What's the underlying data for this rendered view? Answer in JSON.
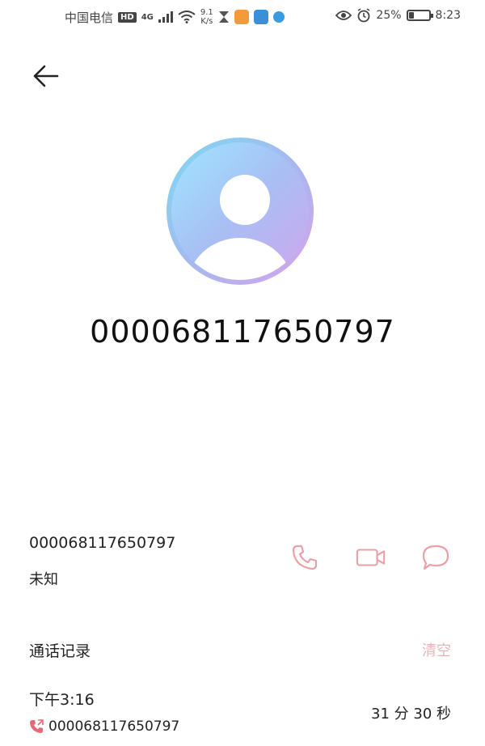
{
  "status_bar": {
    "carrier": "中国电信",
    "hd_badge": "HD",
    "network": "4G",
    "speed_value": "9.1",
    "speed_unit": "K/s",
    "battery": "25%",
    "battery_level": 0.25,
    "time": "8:23",
    "icons": [
      "signal-icon",
      "wifi-icon",
      "hourglass-icon",
      "video-app-icon",
      "gallery-app-icon",
      "browser-app-icon",
      "eye-icon",
      "alarm-icon",
      "battery-icon"
    ]
  },
  "header": {
    "back_icon": "back-arrow-icon"
  },
  "contact": {
    "display_number": "000068117650797",
    "number": "000068117650797",
    "location": "未知"
  },
  "actions": {
    "call_icon": "phone-icon",
    "video_icon": "video-call-icon",
    "message_icon": "message-icon",
    "accent_color": "#e8a0a6"
  },
  "call_log": {
    "title": "通话记录",
    "clear_label": "清空",
    "entries": [
      {
        "time": "下午3:16",
        "number": "000068117650797",
        "duration": "31 分 30 秒",
        "type_icon": "outgoing-call-icon"
      }
    ]
  }
}
